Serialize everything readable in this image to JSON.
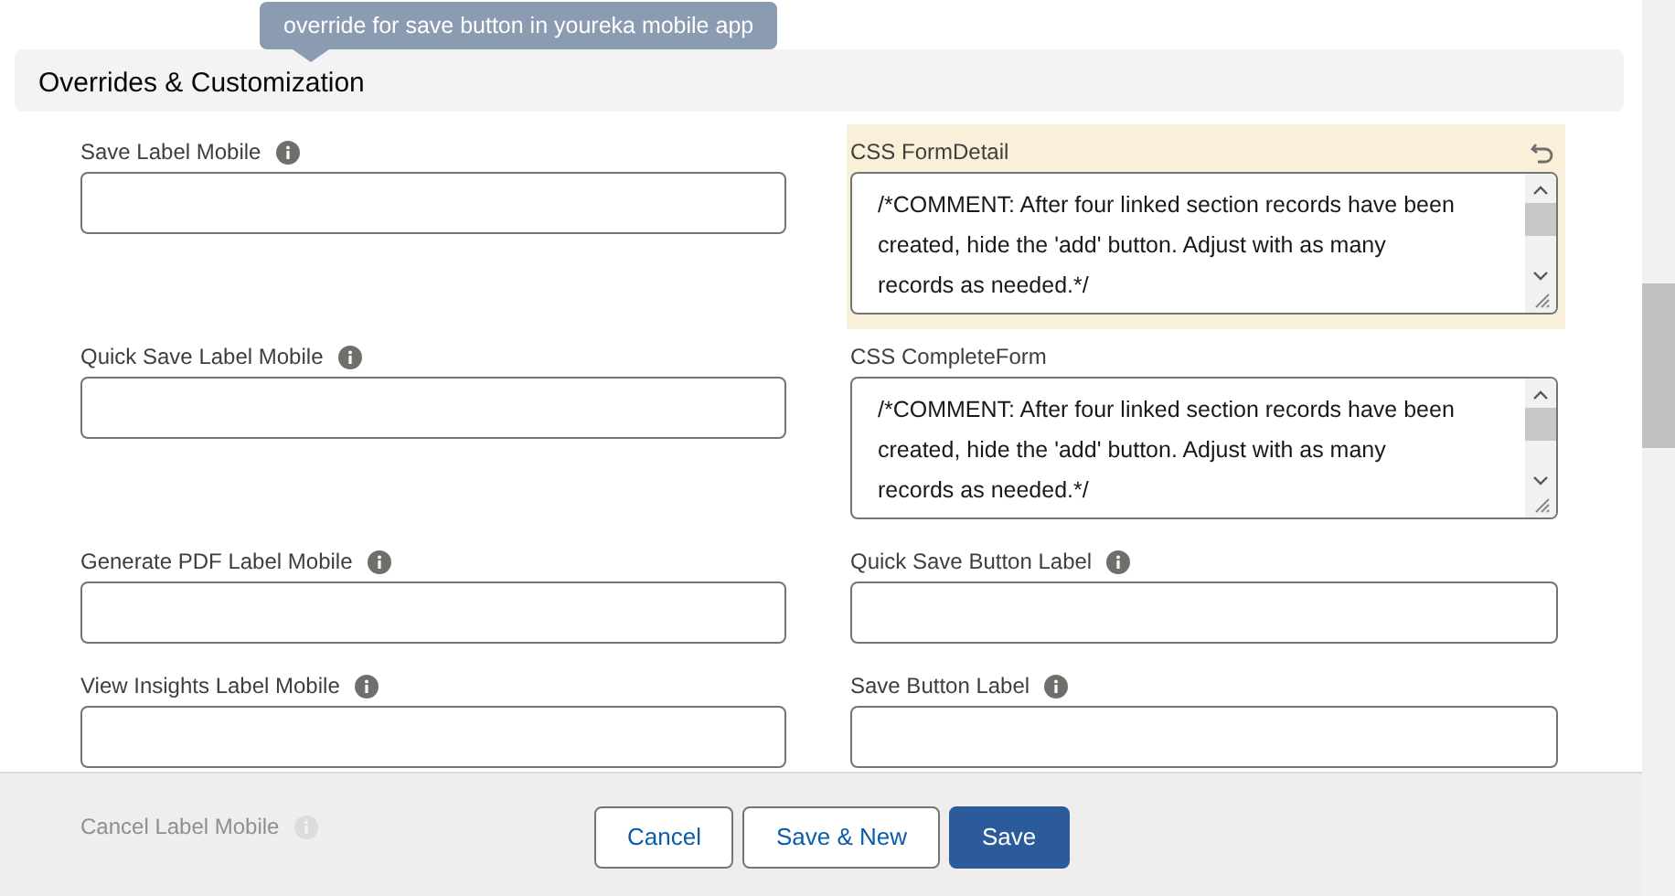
{
  "section": {
    "title": "Overrides & Customization"
  },
  "tooltip": {
    "text": "override for save button in youreka mobile app"
  },
  "fields": [
    {
      "kind": "input",
      "label": "Save Label Mobile",
      "info": true
    },
    {
      "kind": "textarea",
      "label": "CSS FormDetail",
      "info": false,
      "changed": true,
      "value": "/*COMMENT: After four linked section records have been created, hide the 'add' button. Adjust with as many records as needed.*/"
    },
    {
      "kind": "input",
      "label": "Quick Save Label Mobile",
      "info": true
    },
    {
      "kind": "textarea",
      "label": "CSS CompleteForm",
      "info": false,
      "changed": false,
      "value": "/*COMMENT: After four linked section records have been created, hide the 'add' button. Adjust with as many records as needed.*/"
    },
    {
      "kind": "input",
      "label": "Generate PDF Label Mobile",
      "info": true
    },
    {
      "kind": "input",
      "label": "Quick Save Button Label",
      "info": true
    },
    {
      "kind": "input",
      "label": "View Insights Label Mobile",
      "info": true
    },
    {
      "kind": "input",
      "label": "Save Button Label",
      "info": true
    }
  ],
  "hidden_row": {
    "label": "Cancel Label Mobile"
  },
  "buttons": [
    {
      "label": "Cancel",
      "kind": "neutral"
    },
    {
      "label": "Save & New",
      "kind": "neutral"
    },
    {
      "label": "Save",
      "kind": "brand"
    }
  ]
}
